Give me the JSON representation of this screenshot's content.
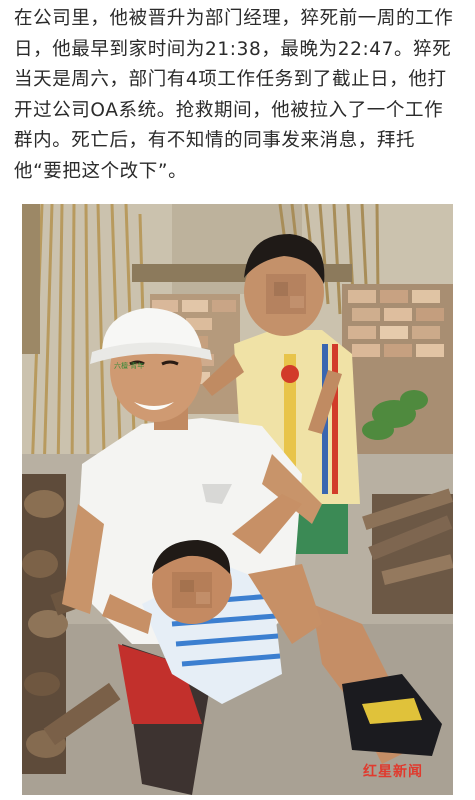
{
  "article": {
    "paragraph": "在公司里，他被晋升为部门经理，猝死前一周的工作日，他最早到家时间为21:38，最晚为22:47。猝死当天是周六，部门有4项工作任务到了截止日，他打开过公司OA系统。抢救期间，他被拉入了一个工作群内。死亡后，有不知情的同事发来消息，拜托他“要把这个改下”。"
  },
  "photo": {
    "cap_text": "六檀·青年",
    "watermark": "红星新闻"
  },
  "colors": {
    "text": "#2b2b2b",
    "watermark": "#e03a2e"
  }
}
